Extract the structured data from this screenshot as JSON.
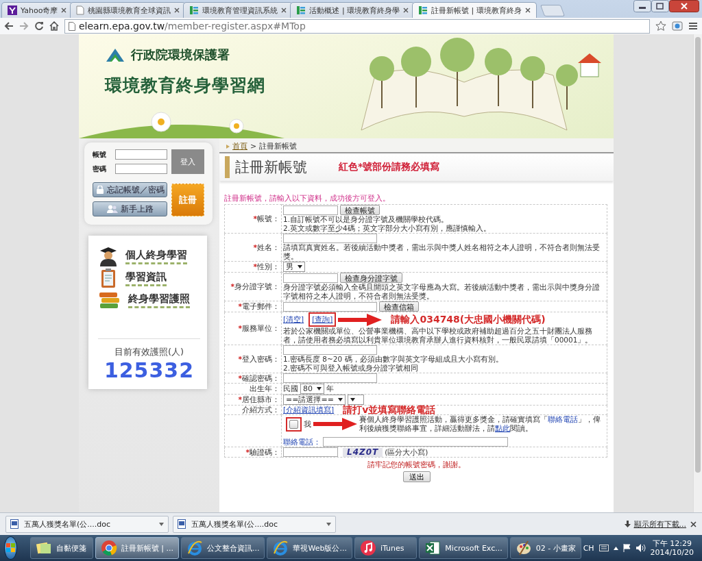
{
  "browser": {
    "tabs": [
      {
        "title": "Yahoo奇摩",
        "selected": false
      },
      {
        "title": "桃園縣環境教育全球資訊",
        "selected": false
      },
      {
        "title": "環境教育管理資訊系統",
        "selected": false
      },
      {
        "title": "活動概述 | 環境教育終身學",
        "selected": false
      },
      {
        "title": "註冊新帳號 | 環境教育終身",
        "selected": true
      }
    ],
    "address": {
      "host": "elearn.epa.gov.tw",
      "path": "/member-register.aspx#MTop"
    }
  },
  "banner": {
    "agency": "行政院環境保護署",
    "site_title": "環境教育終身學習網"
  },
  "login": {
    "fields": [
      {
        "label": "帳號"
      },
      {
        "label": "密碼"
      }
    ],
    "login_button": "登入",
    "forgot_button": "忘記帳號／密碼",
    "guide_button": "新手上路",
    "register_button": "註冊"
  },
  "menu": [
    {
      "label": "個人終身學習"
    },
    {
      "label": "學習資訊"
    },
    {
      "label": "終身學習護照"
    }
  ],
  "passport_counter": {
    "label": "目前有效護照(人)",
    "value": "125332"
  },
  "breadcrumb": {
    "home": "首頁",
    "separator": ">",
    "current": "註冊新帳號"
  },
  "page_title": "註冊新帳號",
  "required_note": "紅色*號部份請務必填寫",
  "intro": "註冊新帳號，請輸入以下資料，成功後方可登入。",
  "form": {
    "rows": [
      {
        "mark": "*",
        "label": "帳號：",
        "controls": [
          {
            "kind": "input"
          },
          {
            "kind": "button",
            "text": "檢查帳號"
          }
        ],
        "notes": [
          "1.自訂帳號不可以是身分證字號及機關學校代碼。",
          "2.英文或數字至少4碼；英文字部分大小寫有別，應謹慎輸入。"
        ]
      },
      {
        "mark": "*",
        "label": "姓名：",
        "controls": [
          {
            "kind": "input"
          }
        ],
        "notes": [
          "請填寫真實姓名。若後續活動中獎者，需出示與中獎人姓名相符之本人證明，不符合者則無法受獎。"
        ]
      },
      {
        "mark": "*",
        "label": "性別：",
        "controls": [
          {
            "kind": "select",
            "value": "男"
          }
        ]
      },
      {
        "mark": "*",
        "label": "身分證字號：",
        "controls": [
          {
            "kind": "input"
          },
          {
            "kind": "button",
            "text": "檢查身分證字號"
          }
        ],
        "notes": [
          "身分證字號必須輸入全碼且開頭之英文字母應為大寫。若後續活動中獎者，需出示與中獎身分證字號相符之本人證明，不符合者則無法受獎。"
        ]
      },
      {
        "mark": "*",
        "label": "電子郵件：",
        "controls": [
          {
            "kind": "input"
          },
          {
            "kind": "button",
            "text": "檢查信箱"
          }
        ]
      },
      {
        "mark": "*",
        "label": "服務單位：",
        "controls": [
          {
            "kind": "link",
            "text": "[清空]"
          },
          {
            "kind": "link",
            "text": "[查詢]",
            "annotated": true
          },
          {
            "kind": "arrow"
          },
          {
            "kind": "annotation",
            "text": "請輸入034748(大忠國小機關代碼)"
          }
        ],
        "notes": [
          "若於公家機關或單位、公營事業機構、高中以下學校或政府補助超過百分之五十財團法人服務者，請使用者務必填寫以利貴單位環境教育承辦人進行資料核對，一般民眾請填「00001」。"
        ]
      },
      {
        "mark": "*",
        "label": "登入密碼：",
        "controls": [
          {
            "kind": "input"
          }
        ],
        "notes": [
          "1.密碼長度 8~20 碼，必須由數字與英文字母組成且大小寫有別。",
          "2.密碼不可與登入帳號或身分證字號相同"
        ]
      },
      {
        "mark": "*",
        "label": "確認密碼：",
        "controls": [
          {
            "kind": "input"
          }
        ]
      },
      {
        "label": "出生年：",
        "controls": [
          {
            "kind": "text",
            "text": "民國"
          },
          {
            "kind": "select",
            "value": "80"
          },
          {
            "kind": "text",
            "text": "年"
          }
        ]
      },
      {
        "mark": "*",
        "label": "居住縣市：",
        "controls": [
          {
            "kind": "select",
            "value": "==請選擇=="
          },
          {
            "kind": "select"
          }
        ]
      },
      {
        "label": "介紹方式：",
        "controls": [
          {
            "kind": "link",
            "text": "[介紹資訊填寫]"
          },
          {
            "kind": "annotation",
            "text": "請打v並填寫聯絡電話"
          }
        ]
      },
      {
        "controls": [
          {
            "kind": "checkbox",
            "checked": false,
            "annotated": true
          },
          {
            "kind": "text",
            "text": "我"
          },
          {
            "kind": "arrow"
          },
          {
            "kind": "sentence",
            "segments": [
              {
                "kind": "text",
                "text": "賽個人終身學習護照活動，贏得更多獎金，請確實填寫「"
              },
              {
                "kind": "highlight",
                "text": "聯絡電話"
              },
              {
                "kind": "text",
                "text": "」，俾利後續獲獎聯絡事宜，詳細活動辦法，請"
              },
              {
                "kind": "link",
                "text": "點此"
              },
              {
                "kind": "text",
                "text": "閱讀。"
              }
            ]
          },
          {
            "kind": "break"
          },
          {
            "kind": "labeled_input",
            "label": "聯絡電話："
          }
        ]
      },
      {
        "mark": "*",
        "label": "驗證碼：",
        "controls": [
          {
            "kind": "input"
          },
          {
            "kind": "captcha",
            "text": "L4Z0T"
          },
          {
            "kind": "text",
            "text": "(區分大小寫)"
          }
        ]
      }
    ]
  },
  "reminder": "請牢記您的帳號密碼，謝謝。",
  "submit_button": "送出",
  "downloads": {
    "items": [
      {
        "name": "五萬人獲獎名單(公....doc"
      },
      {
        "name": "五萬人獲獎名單(公....doc"
      }
    ],
    "show_all": "顯示所有下載..."
  },
  "taskbar": {
    "items": [
      {
        "label": "自黏便箋",
        "selected": false
      },
      {
        "label": "註冊新帳號 | ...",
        "selected": true
      },
      {
        "label": "公文整合資訊...",
        "selected": false
      },
      {
        "label": "華視Web版公...",
        "selected": false
      },
      {
        "label": "iTunes",
        "selected": false
      },
      {
        "label": "Microsoft Exc...",
        "selected": false
      },
      {
        "label": "02 - 小畫家",
        "selected": false
      }
    ],
    "language": "CH",
    "time": "下午 12:29",
    "date": "2014/10/20"
  }
}
